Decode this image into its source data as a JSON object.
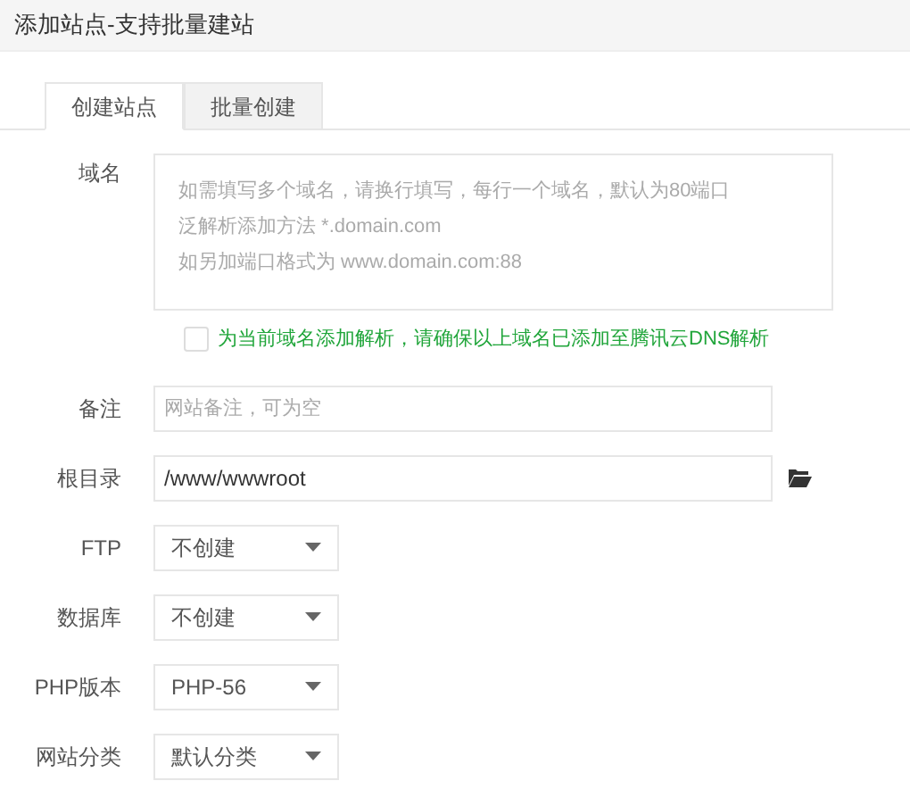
{
  "window": {
    "title": "添加站点-支持批量建站"
  },
  "tabs": [
    {
      "label": "创建站点",
      "selected": true
    },
    {
      "label": "批量创建",
      "selected": false
    }
  ],
  "domain": {
    "label": "域名",
    "placeholder_lines": [
      "如需填写多个域名，请换行填写，每行一个域名，默认为80端口",
      "泛解析添加方法 *.domain.com",
      "如另加端口格式为 www.domain.com:88"
    ]
  },
  "dns_option": {
    "label": "为当前域名添加解析，请确保以上域名已添加至腾讯云DNS解析",
    "checked": false
  },
  "note": {
    "label": "备注",
    "placeholder": "网站备注，可为空"
  },
  "root": {
    "label": "根目录",
    "value": "/www/wwwroot"
  },
  "selects": [
    {
      "label": "FTP",
      "value": "不创建"
    },
    {
      "label": "数据库",
      "value": "不创建"
    },
    {
      "label": "PHP版本",
      "value": "PHP-56"
    },
    {
      "label": "网站分类",
      "value": "默认分类"
    }
  ]
}
